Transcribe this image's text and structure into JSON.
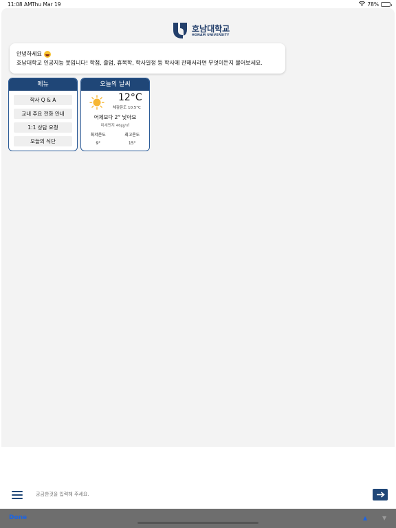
{
  "status_bar": {
    "time": "11:08 AM",
    "date": "Thu Mar 19",
    "battery": "78%",
    "battery_level": 0.78
  },
  "logo": {
    "name_kr": "호남대학교",
    "name_en": "HONAM UNIVERSITY"
  },
  "welcome": {
    "line1": "안녕하세요",
    "line2": "호남대학교 인공지능 봇입니다! 학점, 졸업, 휴복학, 학사일정 등 학사에 관해서라면 무엇이든지 물어보세요."
  },
  "menu_card": {
    "title": "메뉴",
    "items": [
      "학사 Q & A",
      "교내 주요 전화 안내",
      "1:1 상담 요청",
      "오늘의 식단"
    ]
  },
  "weather_card": {
    "title": "오늘의 날씨",
    "temperature": "12°C",
    "feels_like": "체감온도 10.5°C",
    "comparison": "어제보다 2° 낮아요",
    "fine_dust": "미세먼지 46㎍/㎥",
    "min_label": "최저온도",
    "min_value": "9°",
    "max_label": "최고온도",
    "max_value": "15°"
  },
  "input_bar": {
    "placeholder": "궁금한것을 입력해 주세요."
  },
  "accessory_bar": {
    "done_label": "Done"
  },
  "colors": {
    "primary": "#1f4677",
    "accent_link": "#1a64e6",
    "sun": "#f7b733"
  },
  "icons": [
    "wifi-icon",
    "battery-icon",
    "sun-icon",
    "menu-icon",
    "arrow-right-icon",
    "chevron-up-icon",
    "chevron-down-icon"
  ]
}
